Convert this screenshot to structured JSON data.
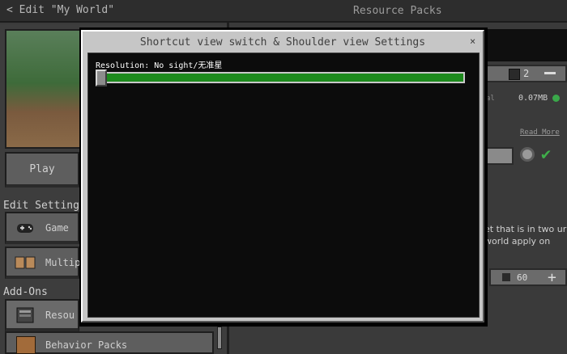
{
  "topbar": {
    "back_label": "< Edit \"My World\"",
    "right_title": "Resource Packs"
  },
  "left": {
    "play_label": "Play",
    "edit_settings_label": "Edit Settings",
    "game_label": "Game",
    "multiplayer_label": "Multipl",
    "addons_label": "Add-Ons",
    "resource_label": "Resou",
    "behavior_label": "Behavior Packs"
  },
  "right": {
    "count": "2",
    "size": "0.07MB",
    "read_more": "Read More",
    "description": "et that is in two ur world apply on",
    "go_count": "60"
  },
  "modal": {
    "title": "Shortcut view switch & Shoulder view Settings",
    "close_label": "×",
    "resolution_label": "Resolution: No sight/无准星",
    "slider_value": 0.0,
    "track_color": "#1d8a1d"
  }
}
